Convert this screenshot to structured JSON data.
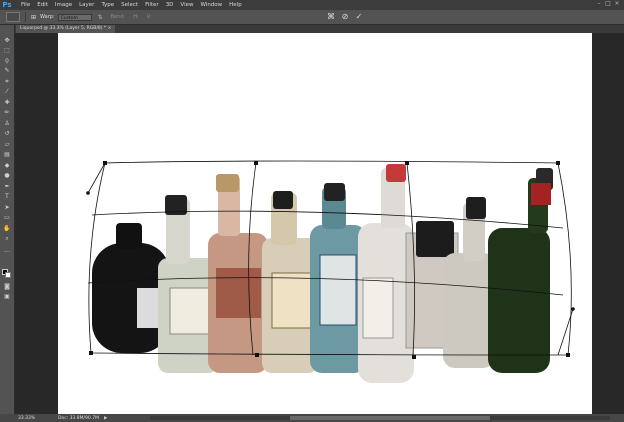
{
  "app": {
    "logo": "Ps"
  },
  "menu": [
    "File",
    "Edit",
    "Image",
    "Layer",
    "Type",
    "Select",
    "Filter",
    "3D",
    "View",
    "Window",
    "Help"
  ],
  "options": {
    "warp_label": "Warp:",
    "warp_value": "Custom",
    "bend_label": "Bend:",
    "h_label": "H:",
    "v_label": "V:"
  },
  "document": {
    "tab_label": "Liquorpsd @ 33.3% (Layer 5, RGB/8) *"
  },
  "status": {
    "zoom": "33.33%",
    "doc_info": "Doc: 33.8M/90.7M"
  },
  "icons": {
    "cancel": "cancel-transform-icon",
    "commit": "commit-transform-icon",
    "warp_toggle": "warp-mode-icon"
  },
  "colors": {
    "accent": "#3ea4ff",
    "panel": "#535353",
    "canvas": "#ffffff"
  }
}
